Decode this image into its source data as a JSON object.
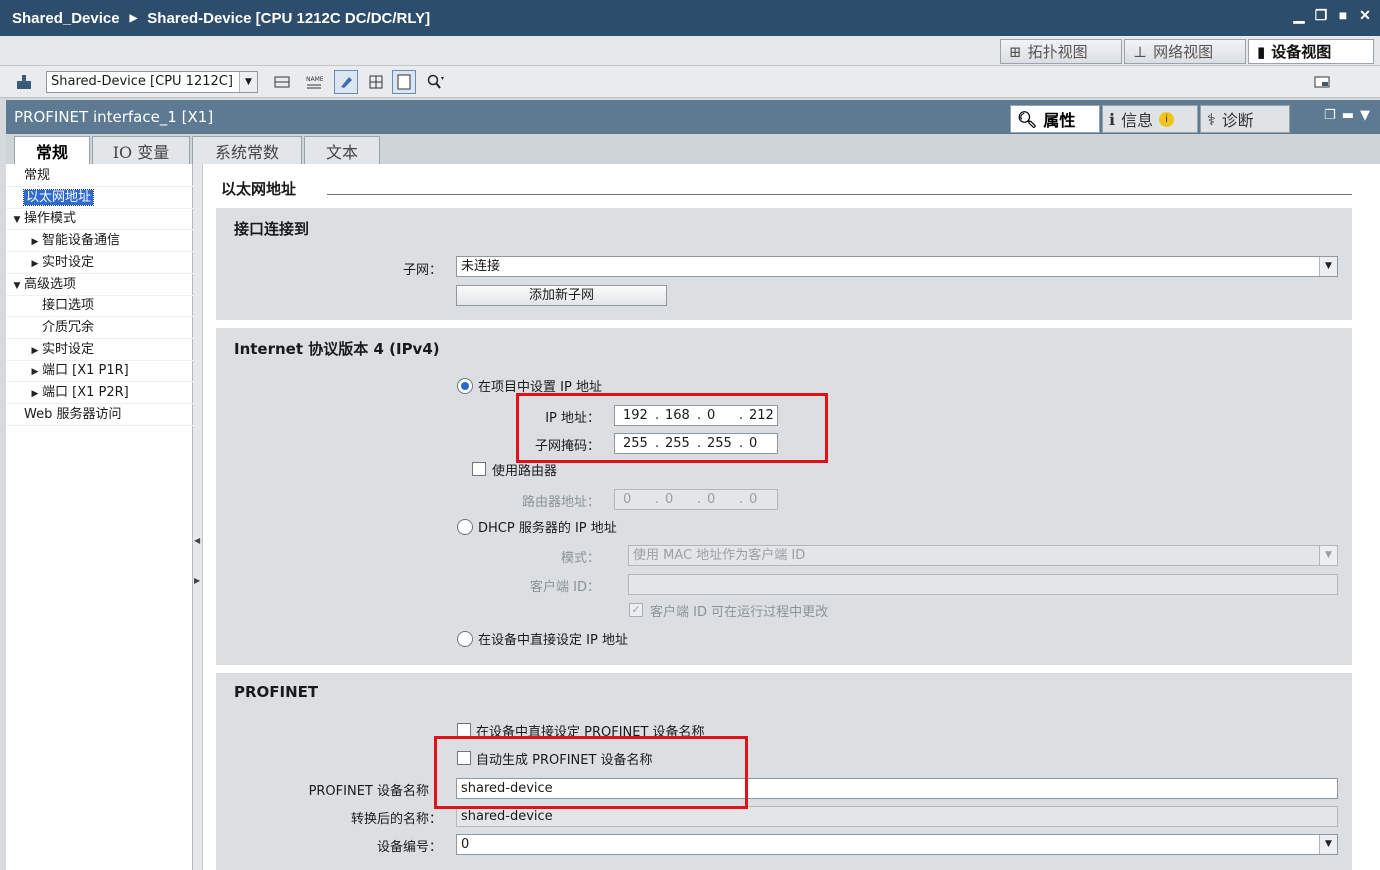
{
  "title": {
    "project": "Shared_Device",
    "device": "Shared-Device [CPU 1212C DC/DC/RLY]"
  },
  "views": {
    "topology": "拓扑视图",
    "network": "网络视图",
    "device": "设备视图"
  },
  "toolbar": {
    "device_select": "Shared-Device [CPU 1212C]"
  },
  "inspector": {
    "header": "PROFINET interface_1 [X1]",
    "tab_properties": "属性",
    "tab_info": "信息",
    "tab_diag": "诊断"
  },
  "subtabs": [
    "常规",
    "IO 变量",
    "系统常数",
    "文本"
  ],
  "nav": [
    {
      "label": "常规",
      "indent": 0,
      "arrow": ""
    },
    {
      "label": "以太网地址",
      "indent": 0,
      "arrow": "",
      "selected": true
    },
    {
      "label": "操作模式",
      "indent": 0,
      "arrow": "down"
    },
    {
      "label": "智能设备通信",
      "indent": 1,
      "arrow": "right"
    },
    {
      "label": "实时设定",
      "indent": 1,
      "arrow": "right"
    },
    {
      "label": "高级选项",
      "indent": 0,
      "arrow": "down"
    },
    {
      "label": "接口选项",
      "indent": 1,
      "arrow": ""
    },
    {
      "label": "介质冗余",
      "indent": 1,
      "arrow": ""
    },
    {
      "label": "实时设定",
      "indent": 1,
      "arrow": "right"
    },
    {
      "label": "端口 [X1 P1R]",
      "indent": 1,
      "arrow": "right"
    },
    {
      "label": "端口 [X1 P2R]",
      "indent": 1,
      "arrow": "right"
    },
    {
      "label": "Web 服务器访问",
      "indent": 0,
      "arrow": ""
    }
  ],
  "content": {
    "section_title": "以太网地址",
    "connect": {
      "title": "接口连接到",
      "subnet_label": "子网：",
      "subnet_value": "未连接",
      "add_button": "添加新子网"
    },
    "ipv4": {
      "title": "Internet 协议版本 4 (IPv4)",
      "opt_project": "在项目中设置 IP 地址",
      "ip_label": "IP 地址：",
      "ip": [
        "192",
        "168",
        "0",
        "212"
      ],
      "mask_label": "子网掩码：",
      "mask": [
        "255",
        "255",
        "255",
        "0"
      ],
      "use_router": "使用路由器",
      "router_label": "路由器地址：",
      "router": [
        "0",
        "0",
        "0",
        "0"
      ],
      "opt_dhcp": "DHCP 服务器的 IP 地址",
      "mode_label": "模式：",
      "mode_value": "使用 MAC 地址作为客户端 ID",
      "client_label": "客户端 ID：",
      "client_value": "",
      "client_changeable": "客户端 ID 可在运行过程中更改",
      "opt_device": "在设备中直接设定 IP 地址"
    },
    "profinet": {
      "title": "PROFINET",
      "direct_name": "在设备中直接设定 PROFINET 设备名称",
      "auto_name": "自动生成 PROFINET 设备名称",
      "name_label": "PROFINET 设备名称",
      "name_value": "shared-device",
      "converted_label": "转换后的名称：",
      "converted_value": "shared-device",
      "number_label": "设备编号：",
      "number_value": "0"
    }
  },
  "colors": {
    "titlebar": "#2c4d6b",
    "panel_header": "#5d7a92",
    "selection": "#2f6ad0",
    "highlight_box": "#e2121a"
  }
}
